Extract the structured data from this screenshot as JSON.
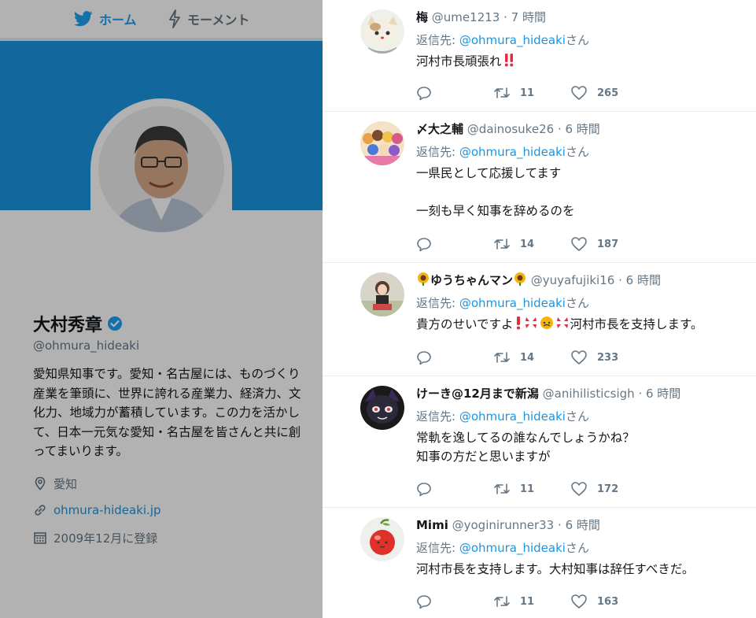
{
  "nav": {
    "home": "ホーム",
    "moments": "モーメント"
  },
  "profile": {
    "name": "大村秀章",
    "handle": "@ohmura_hideaki",
    "bio": "愛知県知事です。愛知・名古屋には、ものづくり産業を筆頭に、世界に誇れる産業力、経済力、文化力、地域力が蓄積しています。この力を活かして、日本一元気な愛知・名古屋を皆さんと共に創ってまいります。",
    "location": "愛知",
    "url": "ohmura-hideaki.jp",
    "joined": "2009年12月に登録"
  },
  "reply_prefix": "返信先: ",
  "reply_target": "@ohmura_hideaki",
  "reply_suffix": "さん",
  "tweets": [
    {
      "name": "梅",
      "handle": "@ume1213",
      "time": "7 時間",
      "text": "河村市長頑張れ",
      "retweets": "11",
      "likes": "265"
    },
    {
      "name": "〆大之輔",
      "handle": "@dainosuke26",
      "time": "6 時間",
      "text": "一県民として応援してます\n\n一刻も早く知事を辞めるのを",
      "retweets": "14",
      "likes": "187"
    },
    {
      "name": "ゆうちゃんマン",
      "handle": "@yuyafujiki16",
      "time": "6 時間",
      "text": "貴方のせいですよ",
      "text_tail": "河村市長を支持します。",
      "retweets": "14",
      "likes": "233"
    },
    {
      "name": "けーき@12月まで新潟",
      "handle": "@anihilisticsigh",
      "time": "6 時間",
      "text": "常軌を逸してるの誰なんでしょうかね？\n知事の方だと思いますが",
      "retweets": "11",
      "likes": "172"
    },
    {
      "name": "Mimi",
      "handle": "@yoginirunner33",
      "time": "6 時間",
      "text": "河村市長を支持します。大村知事は辞任すべきだ。",
      "retweets": "11",
      "likes": "163"
    }
  ],
  "colors": {
    "accent": "#1b95e0",
    "banner": "#1b95e0",
    "overlay": "rgba(0,0,0,0.30)",
    "text": "#14171a",
    "muted": "#657786"
  }
}
